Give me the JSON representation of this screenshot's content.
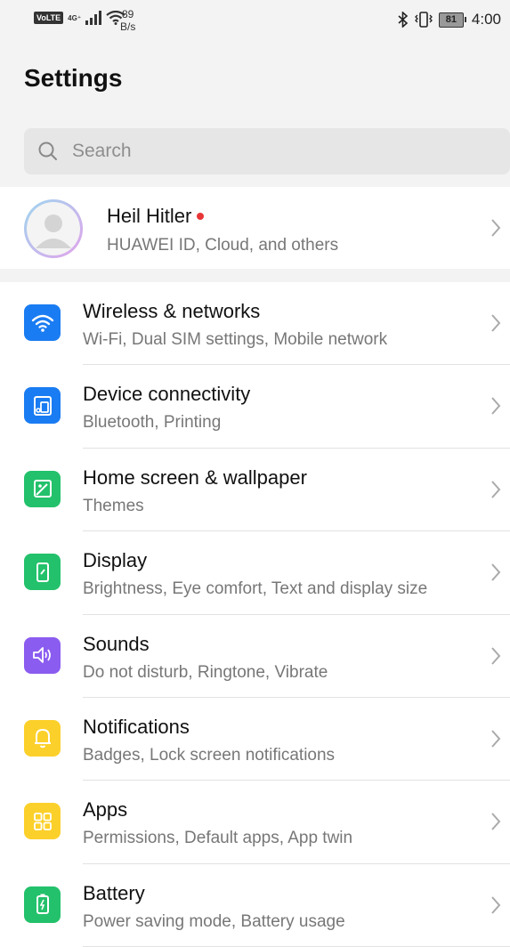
{
  "status_bar": {
    "volte": "VoLTE",
    "network": "4G⁺",
    "speed_value": "89",
    "speed_unit": "B/s",
    "battery": "81",
    "time": "4:00"
  },
  "page_title": "Settings",
  "search": {
    "placeholder": "Search"
  },
  "account": {
    "name": "Heil Hitler",
    "subtitle": "HUAWEI ID, Cloud, and others"
  },
  "items": [
    {
      "label": "Wireless & networks",
      "subtitle": "Wi-Fi, Dual SIM settings, Mobile network",
      "icon": "wifi-icon",
      "color": "#1a7cf2"
    },
    {
      "label": "Device connectivity",
      "subtitle": "Bluetooth, Printing",
      "icon": "device-connectivity-icon",
      "color": "#1a7cf2"
    },
    {
      "label": "Home screen & wallpaper",
      "subtitle": "Themes",
      "icon": "wallpaper-icon",
      "color": "#23c16b"
    },
    {
      "label": "Display",
      "subtitle": "Brightness, Eye comfort, Text and display size",
      "icon": "display-icon",
      "color": "#23c16b"
    },
    {
      "label": "Sounds",
      "subtitle": "Do not disturb, Ringtone, Vibrate",
      "icon": "speaker-icon",
      "color": "#8b5cf0"
    },
    {
      "label": "Notifications",
      "subtitle": "Badges, Lock screen notifications",
      "icon": "bell-icon",
      "color": "#fcd02a"
    },
    {
      "label": "Apps",
      "subtitle": "Permissions, Default apps, App twin",
      "icon": "apps-grid-icon",
      "color": "#fcd02a"
    },
    {
      "label": "Battery",
      "subtitle": "Power saving mode, Battery usage",
      "icon": "battery-icon",
      "color": "#23c16b"
    }
  ]
}
